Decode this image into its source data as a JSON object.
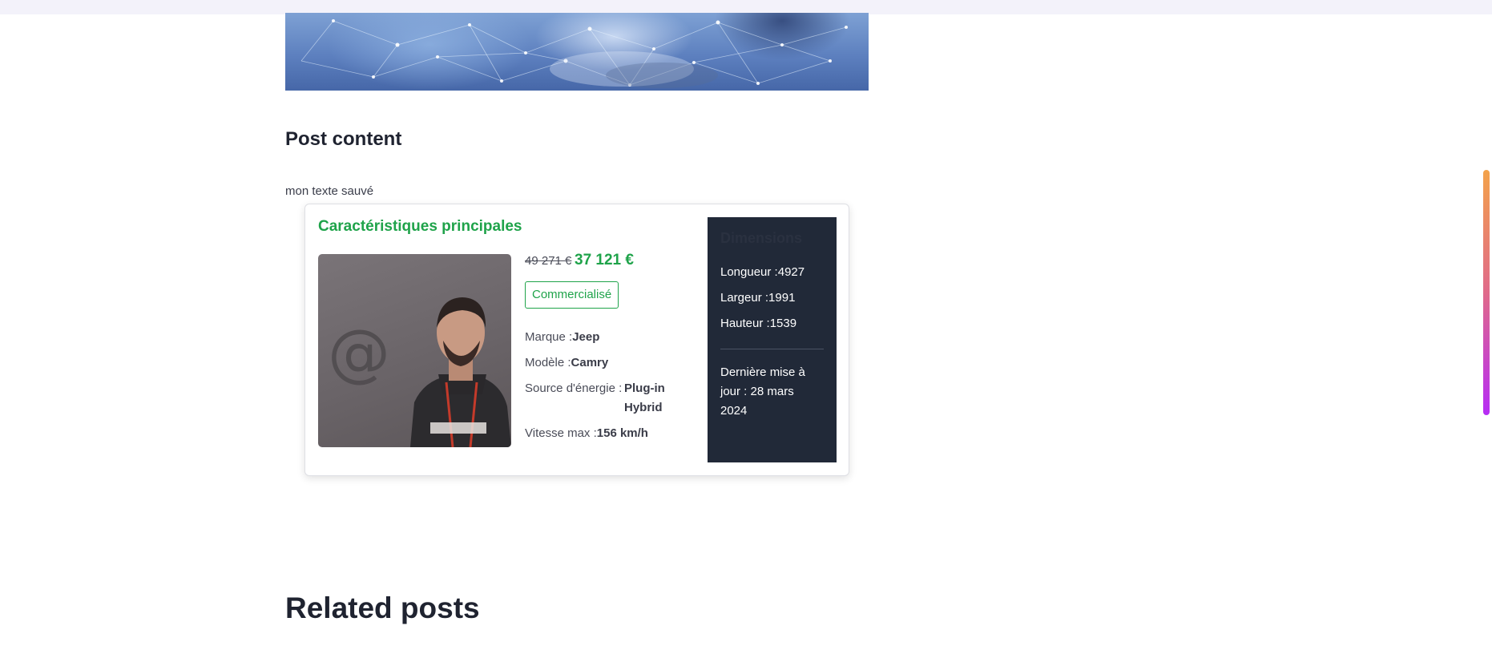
{
  "post": {
    "heading": "Post content",
    "saved_text": "mon texte sauvé"
  },
  "vehicle_card": {
    "title": "Caractéristiques principales",
    "price_old": "49 271 €",
    "price_new": "37 121 €",
    "status": "Commercialisé",
    "specs": {
      "brand_label": "Marque :",
      "brand_value": "Jeep",
      "model_label": "Modèle :",
      "model_value": "Camry",
      "energy_label": "Source d'énergie :",
      "energy_value": "Plug-in Hybrid",
      "speed_label": "Vitesse max :",
      "speed_value": "156 km/h"
    },
    "dimensions": {
      "title": "Dimensions",
      "length": "Longueur :4927",
      "width": "Largeur :1991",
      "height": "Hauteur :1539",
      "last_update": "Dernière mise à jour : 28 mars 2024"
    },
    "photo_icon": "at-sign-icon"
  },
  "related": {
    "heading": "Related posts"
  },
  "colors": {
    "accent_green": "#1fa34a",
    "dark_panel": "#212938",
    "scroll_indicator_gradient": [
      "#f3a24a",
      "#e06a8a",
      "#b62cf5"
    ]
  }
}
